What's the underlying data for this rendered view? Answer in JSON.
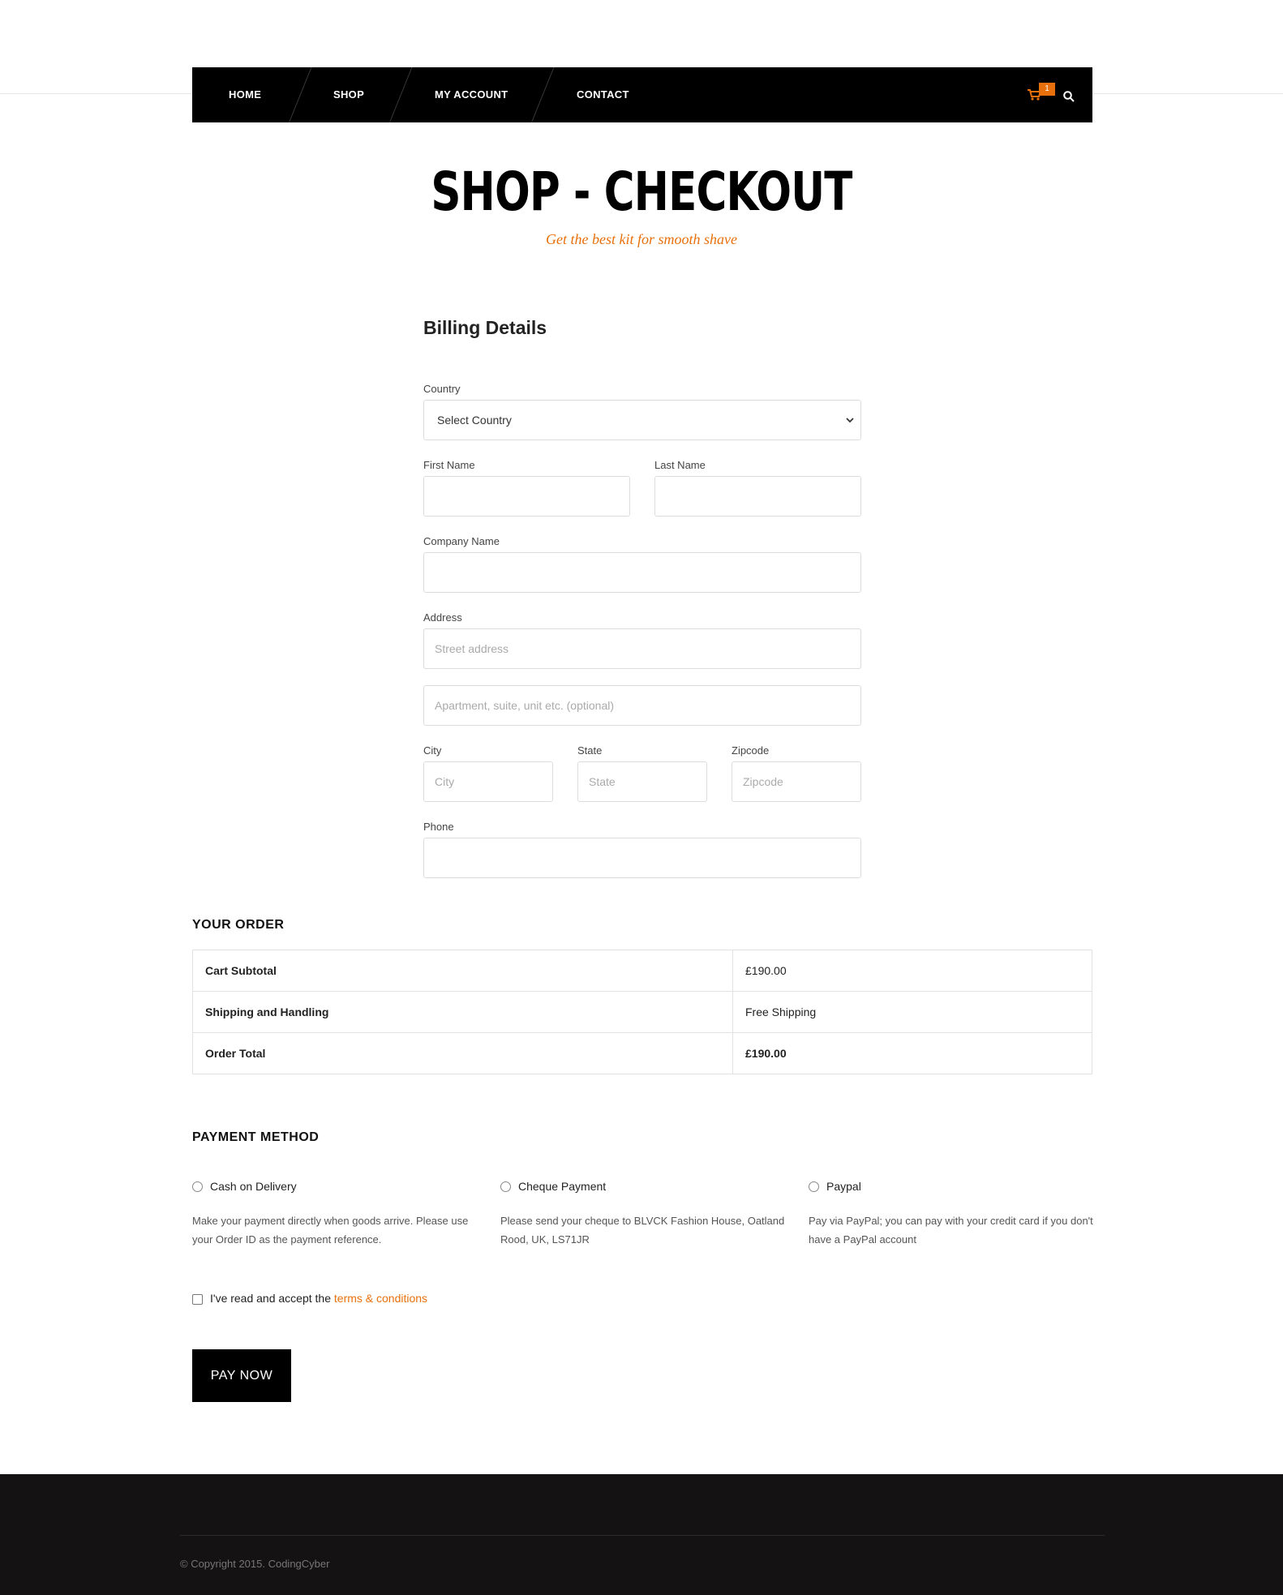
{
  "nav": {
    "items": [
      {
        "label": "HOME"
      },
      {
        "label": "SHOP"
      },
      {
        "label": "MY ACCOUNT"
      },
      {
        "label": "CONTACT"
      }
    ],
    "cart_count": "1",
    "accent_color": "#e8700c"
  },
  "header": {
    "title": "SHOP - CHECKOUT",
    "subtitle": "Get the best kit for smooth shave"
  },
  "billing": {
    "heading": "Billing Details",
    "country_label": "Country",
    "country_value": "Select Country",
    "first_name_label": "First Name",
    "last_name_label": "Last Name",
    "company_label": "Company Name",
    "address_label": "Address",
    "street_placeholder": "Street address",
    "apartment_placeholder": "Apartment, suite, unit etc. (optional)",
    "city_label": "City",
    "city_placeholder": "City",
    "state_label": "State",
    "state_placeholder": "State",
    "zip_label": "Zipcode",
    "zip_placeholder": "Zipcode",
    "phone_label": "Phone"
  },
  "order": {
    "heading": "YOUR ORDER",
    "rows": [
      {
        "label": "Cart Subtotal",
        "value": "£190.00"
      },
      {
        "label": "Shipping and Handling",
        "value": "Free Shipping"
      },
      {
        "label": "Order Total",
        "value": "£190.00"
      }
    ]
  },
  "payment": {
    "heading": "PAYMENT METHOD",
    "methods": [
      {
        "label": "Cash on Delivery",
        "description": "Make your payment directly when goods arrive. Please use your Order ID as the payment reference."
      },
      {
        "label": "Cheque Payment",
        "description": "Please send your cheque to BLVCK Fashion House, Oatland Rood, UK, LS71JR"
      },
      {
        "label": "Paypal",
        "description": "Pay via PayPal; you can pay with your credit card if you don't have a PayPal account"
      }
    ],
    "terms_prefix": "I've read and accept the ",
    "terms_link": "terms & conditions",
    "pay_button": "PAY NOW"
  },
  "footer": {
    "copyright": "© Copyright 2015. CodingCyber"
  }
}
